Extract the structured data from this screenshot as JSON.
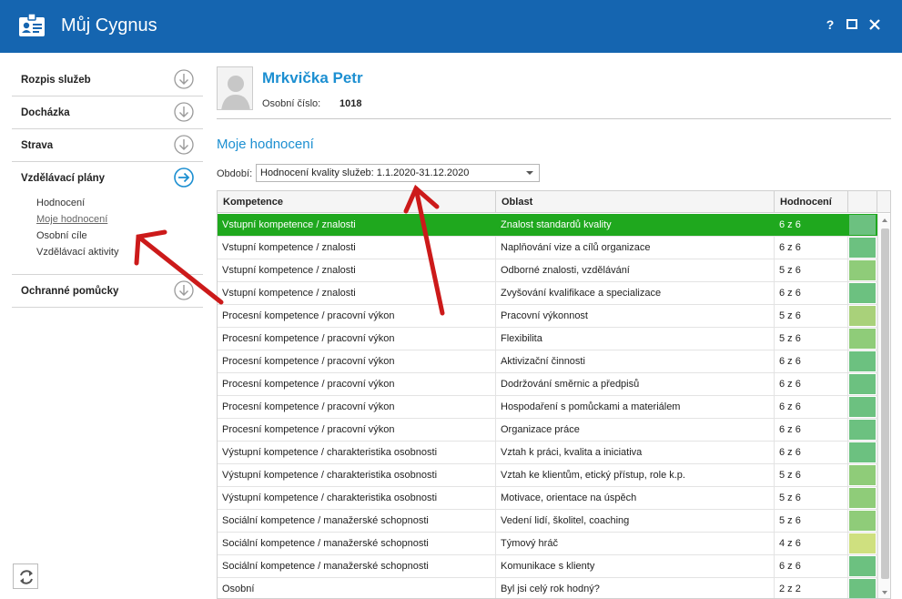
{
  "window": {
    "title": "Můj Cygnus",
    "buttons": [
      "?",
      "□",
      "✕"
    ]
  },
  "sidebar": {
    "items": [
      {
        "label": "Rozpis služeb",
        "icon": "arrow-down-circle-icon"
      },
      {
        "label": "Docházka",
        "icon": "arrow-down-circle-icon"
      },
      {
        "label": "Strava",
        "icon": "arrow-down-circle-icon"
      },
      {
        "label": "Vzdělávací plány",
        "icon": "arrow-right-circle-icon"
      },
      {
        "label": "Ochranné pomůcky",
        "icon": "arrow-down-circle-icon"
      }
    ],
    "subitems": [
      "Hodnocení",
      "Moje hodnocení",
      "Osobní cíle",
      "Vzdělávací aktivity"
    ]
  },
  "profile": {
    "name": "Mrkvička Petr",
    "emp_label": "Osobní číslo:",
    "emp_value": "1018"
  },
  "section": {
    "title": "Moje hodnocení",
    "period_label": "Období:",
    "period_value": "Hodnocení kvality služeb: 1.1.2020-31.12.2020"
  },
  "grid": {
    "headers": [
      "Kompetence",
      "Oblast",
      "Hodnocení",
      ""
    ],
    "rows": [
      {
        "k": "Vstupní kompetence / znalosti",
        "o": "Znalost standardů kvality",
        "h": "6 z 6",
        "color": "#6cc180"
      },
      {
        "k": "Vstupní kompetence / znalosti",
        "o": "Naplňování vize a cílů organizace",
        "h": "6 z 6",
        "color": "#6cc180"
      },
      {
        "k": "Vstupní kompetence / znalosti",
        "o": "Odborné znalosti, vzdělávání",
        "h": "5 z 6",
        "color": "#8fcc79"
      },
      {
        "k": "Vstupní kompetence / znalosti",
        "o": "Zvyšování kvalifikace a specializace",
        "h": "6 z 6",
        "color": "#6cc180"
      },
      {
        "k": "Procesní kompetence / pracovní výkon",
        "o": "Pracovní výkonnost",
        "h": "5 z 6",
        "color": "#a9d17a"
      },
      {
        "k": "Procesní kompetence / pracovní výkon",
        "o": "Flexibilita",
        "h": "5 z 6",
        "color": "#8fcc79"
      },
      {
        "k": "Procesní kompetence / pracovní výkon",
        "o": "Aktivizační činnosti",
        "h": "6 z 6",
        "color": "#6cc180"
      },
      {
        "k": "Procesní kompetence / pracovní výkon",
        "o": "Dodržování směrnic a předpisů",
        "h": "6 z 6",
        "color": "#6cc180"
      },
      {
        "k": "Procesní kompetence / pracovní výkon",
        "o": "Hospodaření s pomůckami a materiálem",
        "h": "6 z 6",
        "color": "#6cc180"
      },
      {
        "k": "Procesní kompetence / pracovní výkon",
        "o": "Organizace práce",
        "h": "6 z 6",
        "color": "#6cc180"
      },
      {
        "k": "Výstupní kompetence / charakteristika osobnosti",
        "o": "Vztah k práci, kvalita a iniciativa",
        "h": "6 z 6",
        "color": "#6cc180"
      },
      {
        "k": "Výstupní kompetence / charakteristika osobnosti",
        "o": "Vztah ke klientům, etický přístup, role k.p.",
        "h": "5 z 6",
        "color": "#8fcc79"
      },
      {
        "k": "Výstupní kompetence / charakteristika osobnosti",
        "o": "Motivace, orientace na úspěch",
        "h": "5 z 6",
        "color": "#8fcc79"
      },
      {
        "k": "Sociální kompetence / manažerské schopnosti",
        "o": "Vedení lidí, školitel, coaching",
        "h": "5 z 6",
        "color": "#8fcc79"
      },
      {
        "k": "Sociální kompetence / manažerské schopnosti",
        "o": "Týmový hráč",
        "h": "4 z 6",
        "color": "#cfe07f"
      },
      {
        "k": "Sociální kompetence / manažerské schopnosti",
        "o": "Komunikace s klienty",
        "h": "6 z 6",
        "color": "#6cc180"
      },
      {
        "k": "Osobní",
        "o": "Byl jsi celý rok hodný?",
        "h": "2 z 2",
        "color": "#6cc180"
      }
    ]
  },
  "colors": {
    "titlebar": "#1565b0",
    "accent": "#1c8fd1",
    "selected_row": "#1fa81e",
    "annotation_arrow": "#cc1a1a"
  }
}
